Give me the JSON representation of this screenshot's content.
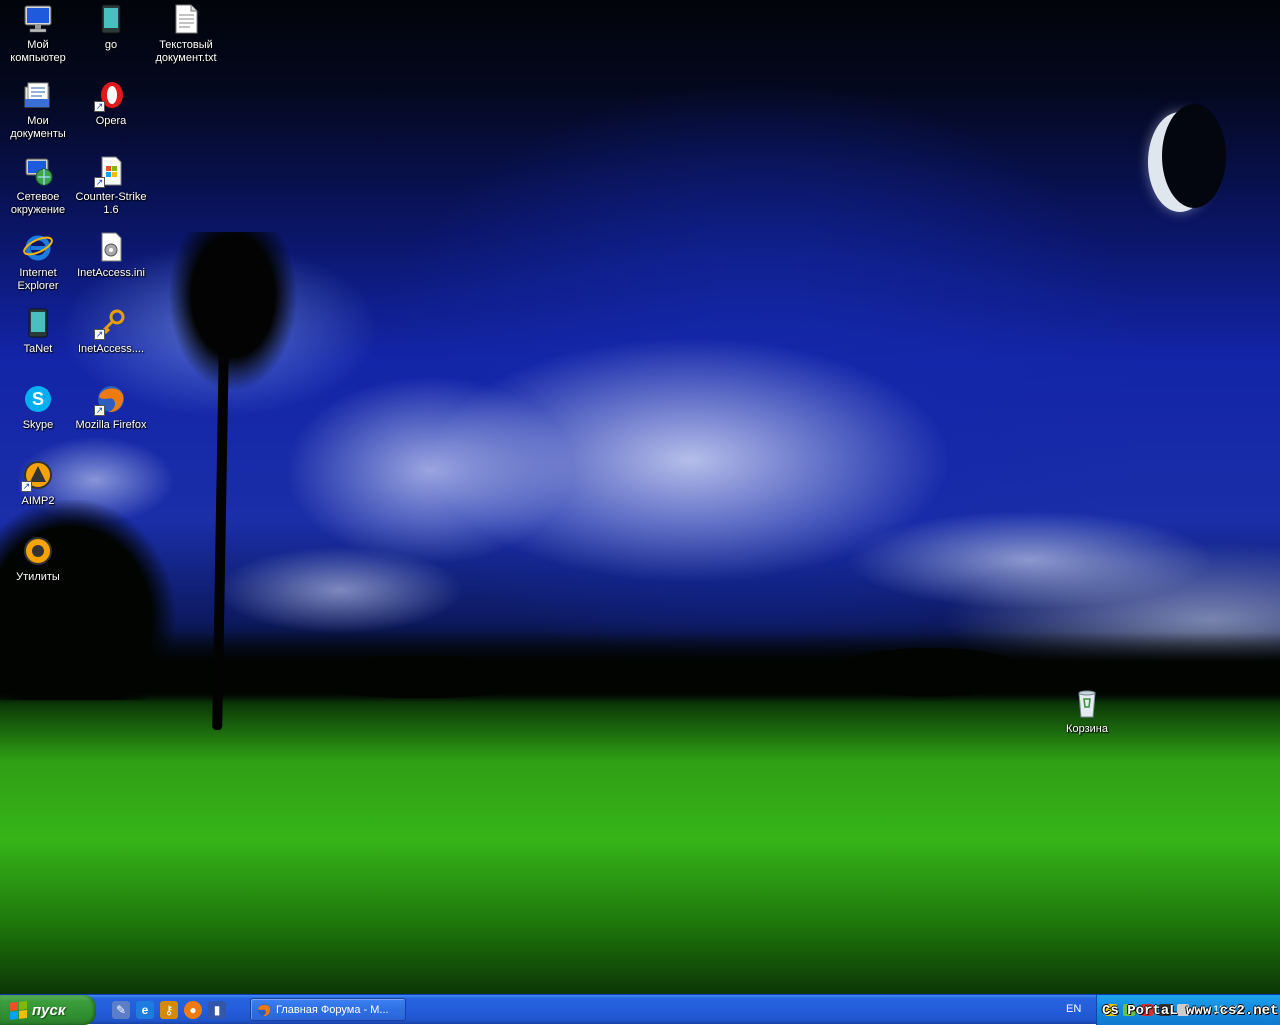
{
  "desktop": {
    "icons": [
      {
        "label": "Мой\nкомпьютер",
        "icon": "my-computer-icon"
      },
      {
        "label": "go",
        "icon": "go-device-icon"
      },
      {
        "label": "Текстовый\nдокумент.txt",
        "icon": "text-document-icon"
      },
      {
        "label": "Мои\nдокументы",
        "icon": "my-documents-icon"
      },
      {
        "label": "Opera",
        "icon": "opera-icon"
      },
      {
        "label": "Сетевое\nокружение",
        "icon": "network-places-icon"
      },
      {
        "label": "Counter-Strike\n1.6",
        "icon": "counter-strike-icon"
      },
      {
        "label": "Internet\nExplorer",
        "icon": "internet-explorer-icon"
      },
      {
        "label": "InetAccess.ini",
        "icon": "ini-file-icon"
      },
      {
        "label": "TaNet",
        "icon": "tanet-icon"
      },
      {
        "label": "InetAccess....",
        "icon": "keys-icon"
      },
      {
        "label": "Skype",
        "icon": "skype-icon"
      },
      {
        "label": "Mozilla Firefox",
        "icon": "firefox-icon"
      },
      {
        "label": "AIMP2",
        "icon": "aimp-icon"
      },
      {
        "label": "Утилиты",
        "icon": "utilities-icon"
      },
      {
        "label": "Корзина",
        "icon": "recycle-bin-icon"
      }
    ]
  },
  "taskbar": {
    "start_label": "пуск",
    "task_label": "Главная Форума - М...",
    "language": "EN",
    "clock": "18:00"
  },
  "watermark": "Cs PortaL www.cs2.net.ru",
  "colors": {
    "taskbar_blue": "#245edb",
    "start_green": "#3c9e3c",
    "tray_blue": "#148ee0"
  }
}
